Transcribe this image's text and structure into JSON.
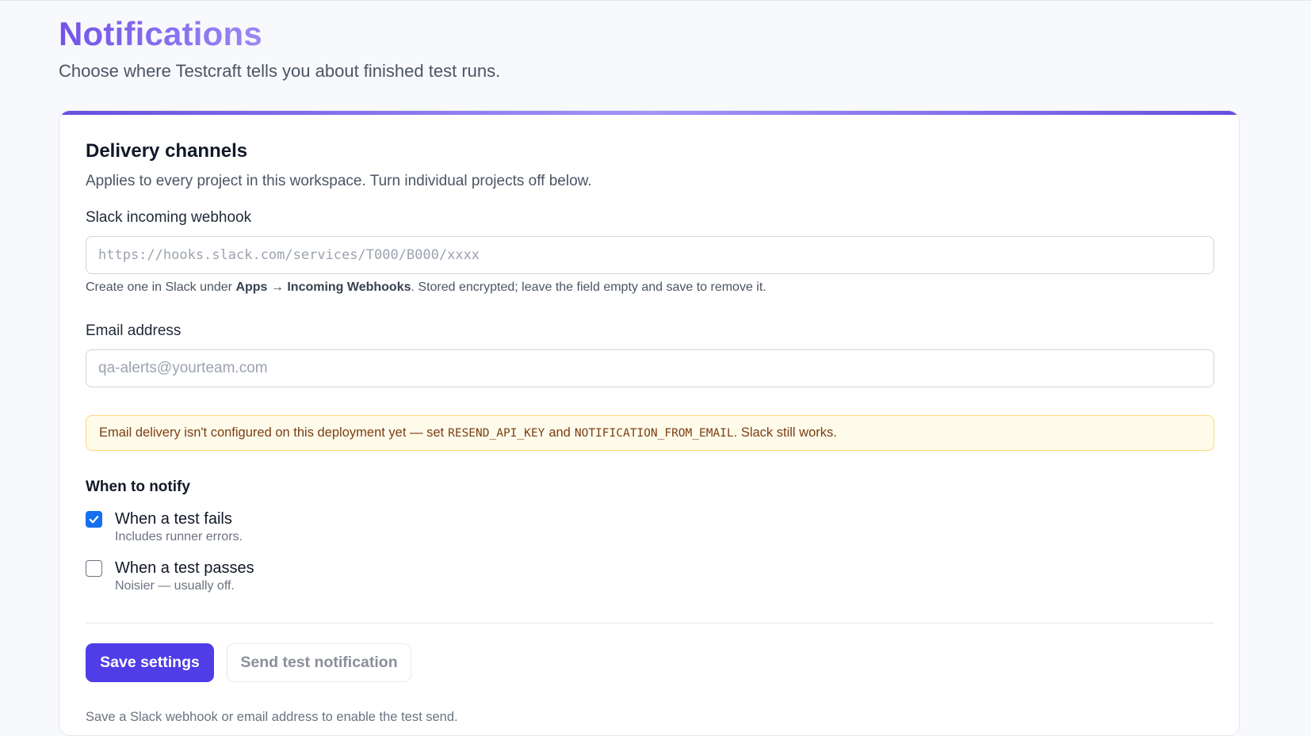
{
  "header": {
    "title": "Notifications",
    "subtitle": "Choose where Testcraft tells you about finished test runs."
  },
  "card": {
    "title": "Delivery channels",
    "description": "Applies to every project in this workspace. Turn individual projects off below."
  },
  "slack": {
    "label": "Slack incoming webhook",
    "value": "",
    "placeholder": "https://hooks.slack.com/services/T000/B000/xxxx",
    "help_prefix": "Create one in Slack under ",
    "help_path": "Apps → Incoming Webhooks",
    "help_suffix": ". Stored encrypted; leave the field empty and save to remove it."
  },
  "email": {
    "label": "Email address",
    "value": "",
    "placeholder": "qa-alerts@yourteam.com"
  },
  "warning": {
    "prefix": "Email delivery isn't configured on this deployment yet — set",
    "key1": "RESEND_API_KEY",
    "joiner": "and",
    "key2": "NOTIFICATION_FROM_EMAIL",
    "suffix": ". Slack still works."
  },
  "when_to_notify": {
    "title": "When to notify",
    "options": [
      {
        "label": "When a test fails",
        "hint": "Includes runner errors.",
        "checked": true
      },
      {
        "label": "When a test passes",
        "hint": "Noisier — usually off.",
        "checked": false
      }
    ]
  },
  "actions": {
    "save_label": "Save settings",
    "test_label": "Send test notification"
  },
  "footnote": "Save a Slack webhook or email address to enable the test send.",
  "colors": {
    "accent": "#4f3de8",
    "checkbox": "#1570ef",
    "warning_bg": "#fffbeb",
    "warning_border": "#fcd97a",
    "warning_text": "#7a3e12"
  }
}
